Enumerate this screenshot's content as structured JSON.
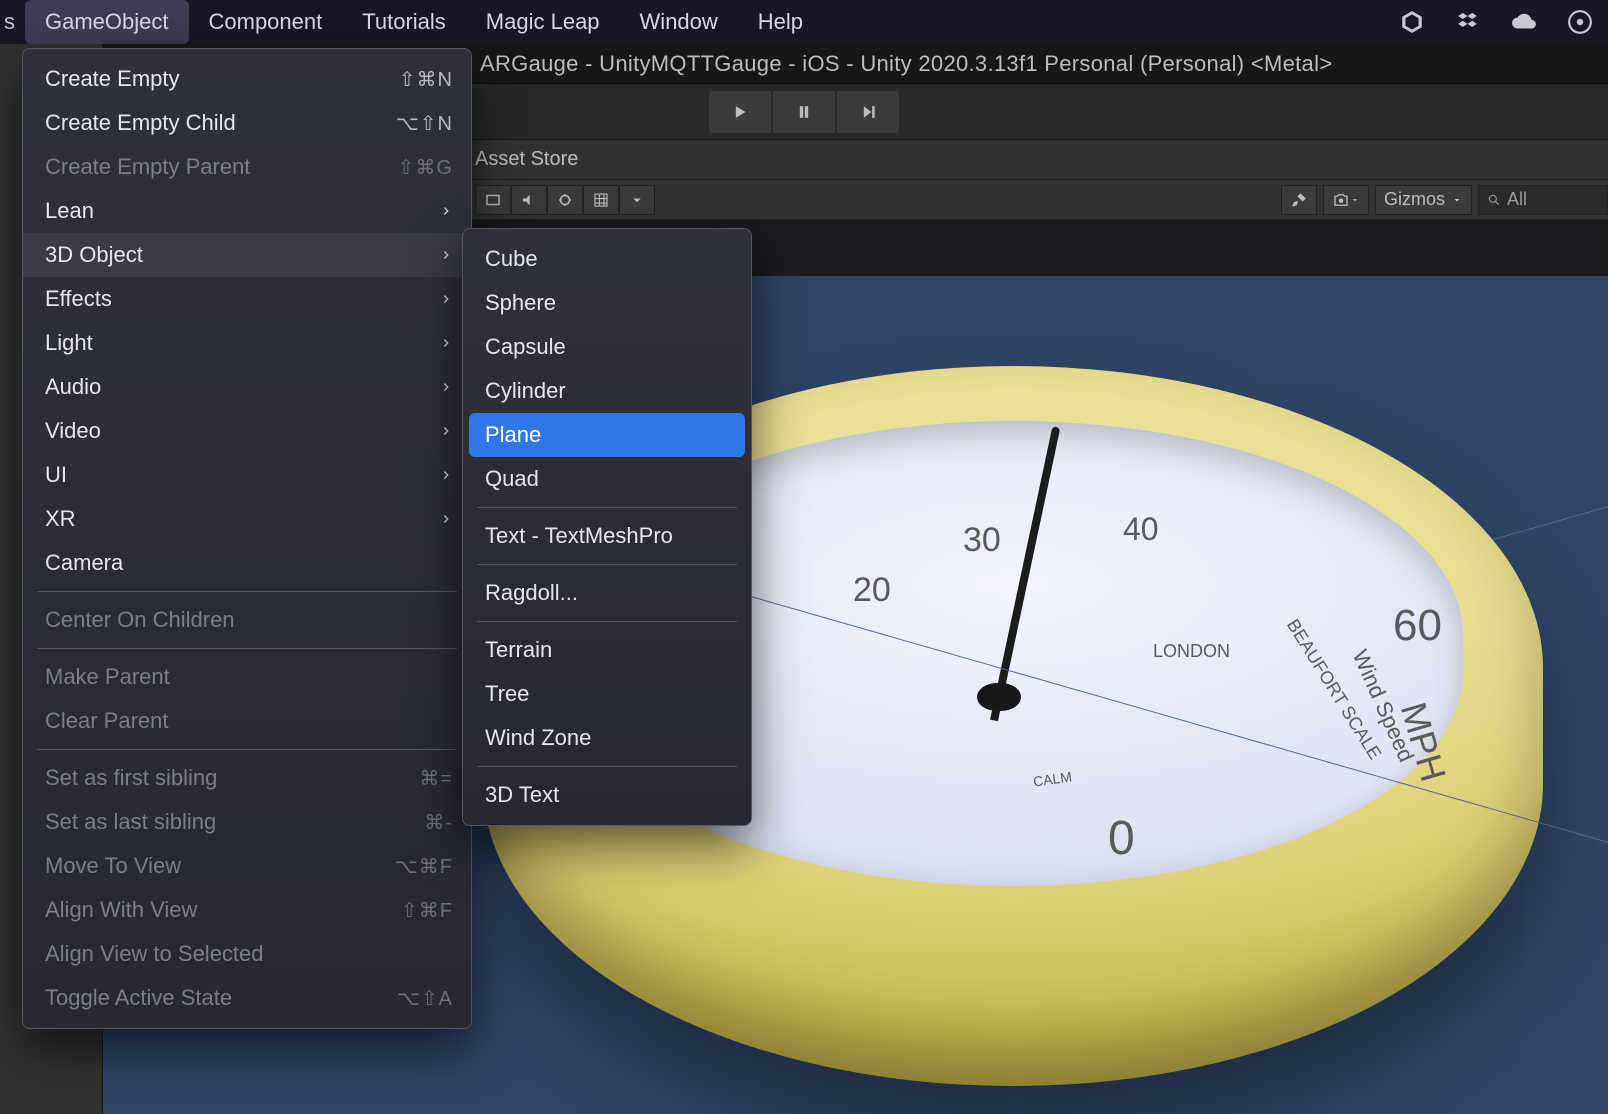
{
  "menubar": {
    "truncated_left": "s",
    "items": [
      "GameObject",
      "Component",
      "Tutorials",
      "Magic Leap",
      "Window",
      "Help"
    ],
    "active_index": 0
  },
  "titlebar": {
    "text": "ARGauge - UnityMQTTGauge - iOS - Unity 2020.3.13f1 Personal (Personal) <Metal>"
  },
  "tabsrow": {
    "asset_store_label": "Asset Store"
  },
  "scene_toolbar": {
    "gizmos_label": "Gizmos",
    "search_placeholder": "All"
  },
  "dropdown": {
    "items": [
      {
        "label": "Create Empty",
        "shortcut": "⇧⌘N",
        "disabled": false,
        "submenu": false
      },
      {
        "label": "Create Empty Child",
        "shortcut": "⌥⇧N",
        "disabled": false,
        "submenu": false
      },
      {
        "label": "Create Empty Parent",
        "shortcut": "⇧⌘G",
        "disabled": true,
        "submenu": false
      },
      {
        "label": "Lean",
        "shortcut": "",
        "disabled": false,
        "submenu": true
      },
      {
        "label": "3D Object",
        "shortcut": "",
        "disabled": false,
        "submenu": true,
        "open": true
      },
      {
        "label": "Effects",
        "shortcut": "",
        "disabled": false,
        "submenu": true
      },
      {
        "label": "Light",
        "shortcut": "",
        "disabled": false,
        "submenu": true
      },
      {
        "label": "Audio",
        "shortcut": "",
        "disabled": false,
        "submenu": true
      },
      {
        "label": "Video",
        "shortcut": "",
        "disabled": false,
        "submenu": true
      },
      {
        "label": "UI",
        "shortcut": "",
        "disabled": false,
        "submenu": true
      },
      {
        "label": "XR",
        "shortcut": "",
        "disabled": false,
        "submenu": true
      },
      {
        "label": "Camera",
        "shortcut": "",
        "disabled": false,
        "submenu": false
      },
      {
        "sep": true
      },
      {
        "label": "Center On Children",
        "shortcut": "",
        "disabled": true,
        "submenu": false
      },
      {
        "sep": true
      },
      {
        "label": "Make Parent",
        "shortcut": "",
        "disabled": true,
        "submenu": false
      },
      {
        "label": "Clear Parent",
        "shortcut": "",
        "disabled": true,
        "submenu": false
      },
      {
        "sep": true
      },
      {
        "label": "Set as first sibling",
        "shortcut": "⌘=",
        "disabled": true,
        "submenu": false
      },
      {
        "label": "Set as last sibling",
        "shortcut": "⌘-",
        "disabled": true,
        "submenu": false
      },
      {
        "label": "Move To View",
        "shortcut": "⌥⌘F",
        "disabled": true,
        "submenu": false
      },
      {
        "label": "Align With View",
        "shortcut": "⇧⌘F",
        "disabled": true,
        "submenu": false
      },
      {
        "label": "Align View to Selected",
        "shortcut": "",
        "disabled": true,
        "submenu": false
      },
      {
        "label": "Toggle Active State",
        "shortcut": "⌥⇧A",
        "disabled": true,
        "submenu": false
      }
    ]
  },
  "submenu": {
    "items": [
      {
        "label": "Cube"
      },
      {
        "label": "Sphere"
      },
      {
        "label": "Capsule"
      },
      {
        "label": "Cylinder"
      },
      {
        "label": "Plane",
        "highlight": true
      },
      {
        "label": "Quad"
      },
      {
        "sep": true
      },
      {
        "label": "Text - TextMeshPro"
      },
      {
        "sep": true
      },
      {
        "label": "Ragdoll..."
      },
      {
        "sep": true
      },
      {
        "label": "Terrain"
      },
      {
        "label": "Tree"
      },
      {
        "label": "Wind Zone"
      },
      {
        "sep": true
      },
      {
        "label": "3D Text"
      }
    ]
  },
  "gauge": {
    "numbers": {
      "n0": "0",
      "n20": "20",
      "n30": "30",
      "n40": "40",
      "n60": "60"
    },
    "labels": {
      "mph": "MPH",
      "windspeed": "Wind Speed",
      "beaufort": "BEAUFORT SCALE",
      "london": "LONDON",
      "calm": "CALM"
    }
  }
}
